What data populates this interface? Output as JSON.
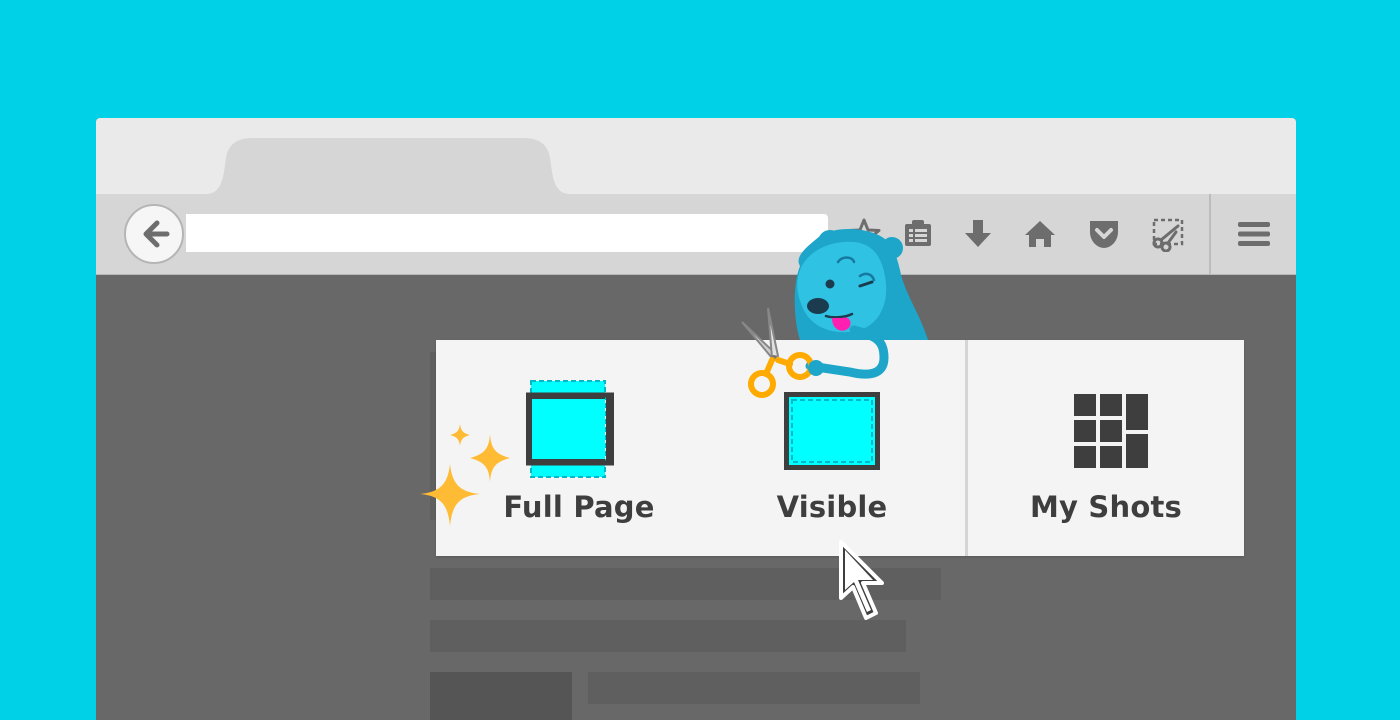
{
  "colors": {
    "background": "#00d1e6",
    "accent_cyan": "#00ffff",
    "icon_dark": "#3e3e3e",
    "sparkle": "#ffbb33",
    "mascot": "#1da6c9"
  },
  "browser": {
    "toolbar_icons": [
      "back-arrow-icon",
      "star-icon",
      "reading-list-icon",
      "download-icon",
      "home-icon",
      "pocket-icon",
      "screenshot-scissors-icon",
      "hamburger-menu-icon"
    ]
  },
  "screenshot_panel": {
    "options": [
      {
        "id": "full-page",
        "label": "Full Page",
        "icon": "full-page-icon"
      },
      {
        "id": "visible",
        "label": "Visible",
        "icon": "visible-area-icon"
      },
      {
        "id": "my-shots",
        "label": "My Shots",
        "icon": "my-shots-grid-icon"
      }
    ]
  }
}
